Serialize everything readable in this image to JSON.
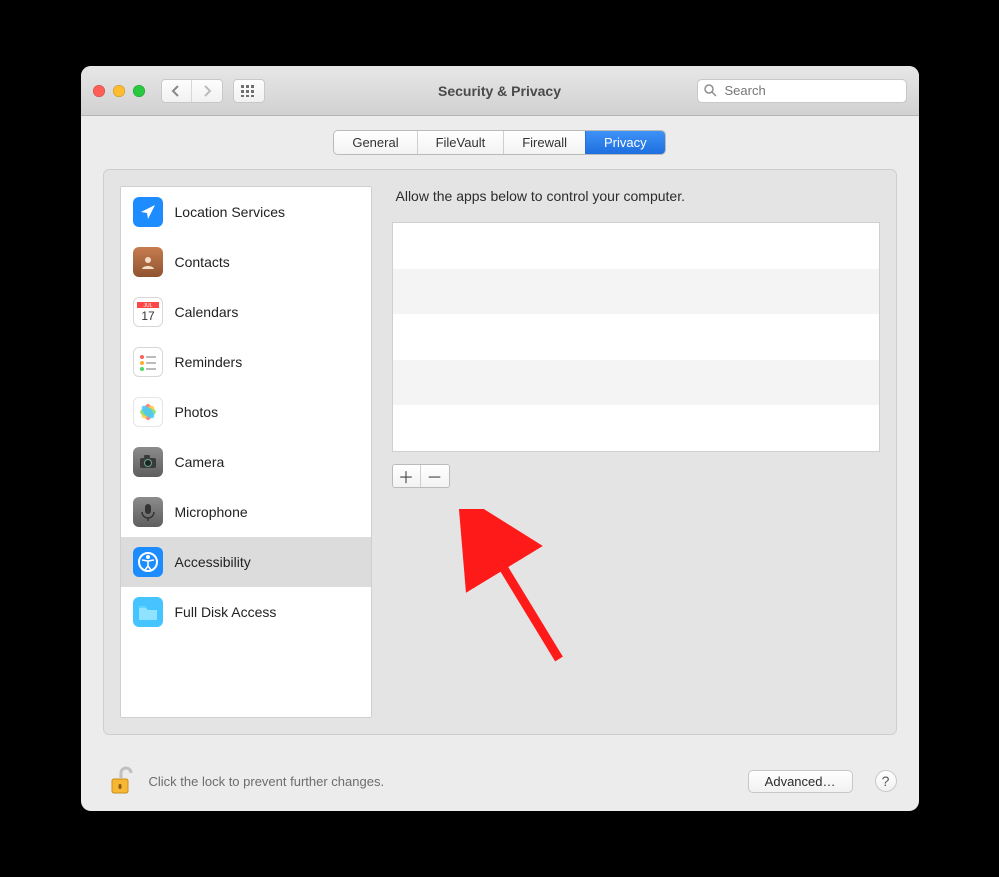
{
  "window": {
    "title": "Security & Privacy"
  },
  "search": {
    "placeholder": "Search",
    "value": ""
  },
  "tabs": [
    {
      "label": "General",
      "active": false
    },
    {
      "label": "FileVault",
      "active": false
    },
    {
      "label": "Firewall",
      "active": false
    },
    {
      "label": "Privacy",
      "active": true
    }
  ],
  "sidebar": {
    "items": [
      {
        "id": "location-services",
        "label": "Location Services",
        "selected": false
      },
      {
        "id": "contacts",
        "label": "Contacts",
        "selected": false
      },
      {
        "id": "calendars",
        "label": "Calendars",
        "selected": false
      },
      {
        "id": "reminders",
        "label": "Reminders",
        "selected": false
      },
      {
        "id": "photos",
        "label": "Photos",
        "selected": false
      },
      {
        "id": "camera",
        "label": "Camera",
        "selected": false
      },
      {
        "id": "microphone",
        "label": "Microphone",
        "selected": false
      },
      {
        "id": "accessibility",
        "label": "Accessibility",
        "selected": true
      },
      {
        "id": "full-disk-access",
        "label": "Full Disk Access",
        "selected": false
      }
    ]
  },
  "detail": {
    "description": "Allow the apps below to control your computer.",
    "apps": []
  },
  "footer": {
    "lock_hint": "Click the lock to prevent further changes.",
    "advanced_label": "Advanced…",
    "help_label": "?"
  },
  "icons": {
    "back": "‹",
    "forward": "›",
    "add": "＋",
    "remove": "－"
  },
  "annotation": {
    "type": "arrow",
    "color": "#ff1a1a",
    "target": "add-app-button"
  }
}
